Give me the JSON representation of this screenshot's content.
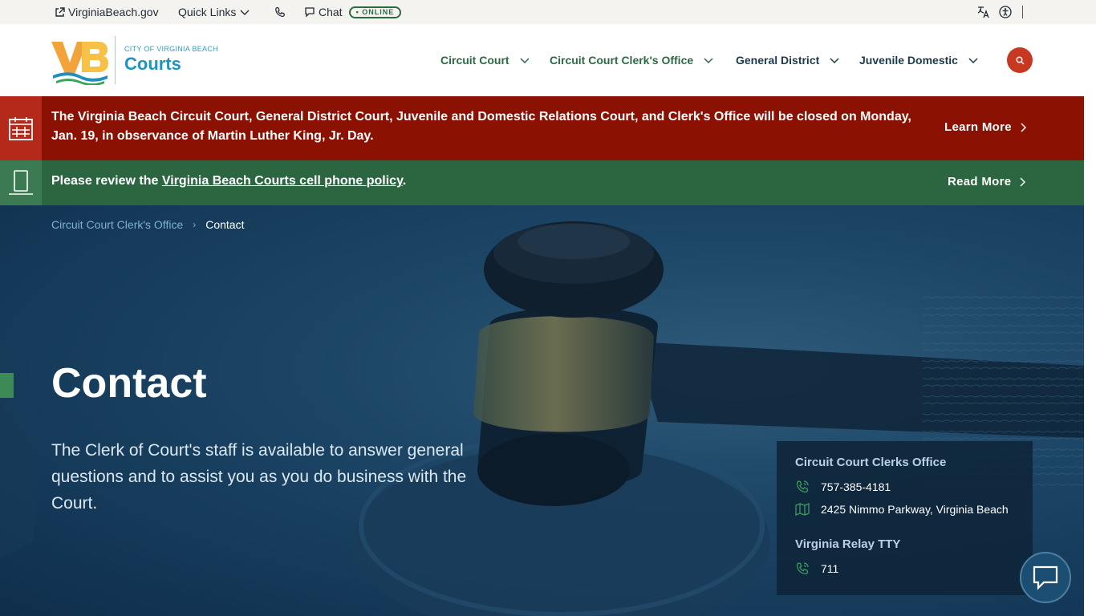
{
  "utility": {
    "site_link": "VirginiaBeach.gov",
    "quick_links": "Quick Links",
    "chat": "Chat",
    "chat_status": "• ONLINE"
  },
  "header": {
    "logo_city": "CITY OF VIRGINIA BEACH",
    "logo_courts": "Courts",
    "nav": [
      {
        "label": "Circuit Court"
      },
      {
        "label": "Circuit Court Clerk's Office"
      },
      {
        "label": "General District"
      },
      {
        "label": "Juvenile Domestic"
      }
    ]
  },
  "alerts": {
    "closure_text": "The Virginia Beach Circuit Court, General District Court, Juvenile and Domestic Relations Court, and Clerk's Office will be closed on Monday, Jan. 19, in observance of Martin Luther King, Jr. Day.",
    "closure_link": "Learn More",
    "policy_prefix": "Please review the ",
    "policy_link_text": "Virginia Beach Courts cell phone policy",
    "policy_suffix": ".",
    "policy_link": "Read More"
  },
  "hero": {
    "breadcrumb_parent": "Circuit Court Clerk's Office",
    "breadcrumb_current": "Contact",
    "title": "Contact",
    "description": "The Clerk of Court's staff is available to answer general questions and to assist you as you do business with the Court."
  },
  "contact_card": {
    "office_heading": "Circuit Court Clerks Office",
    "phone": "757-385-4181",
    "address": "2425 Nimmo Parkway, Virginia Beach",
    "relay_heading": "Virginia Relay TTY",
    "relay_number": "711"
  },
  "colors": {
    "brand_red": "#c8371f",
    "alert_red": "#8b1103",
    "alert_green": "#2c6641",
    "nav_green": "#2c6a43",
    "nav_navy": "#1b3a4b"
  }
}
